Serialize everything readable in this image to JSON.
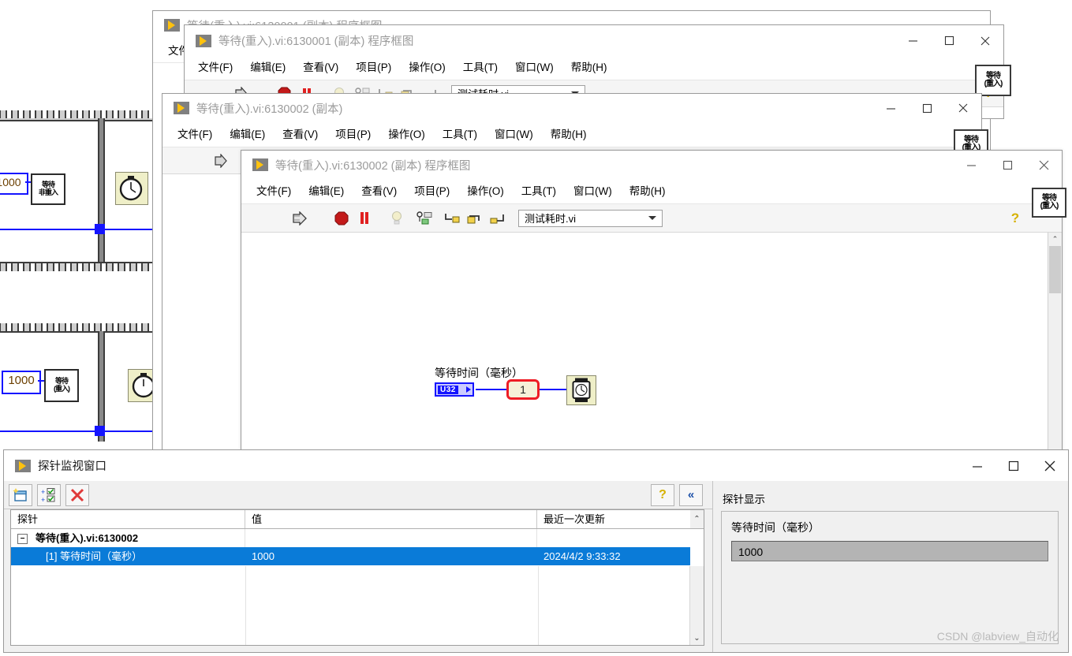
{
  "background_diagram": {
    "name": "caller-block-diagram",
    "constants": [
      "1000",
      "1000"
    ],
    "subvi_top": {
      "line1": "等待",
      "line2": "非重入"
    },
    "subvi_bottom": {
      "line1": "等待",
      "line2": "(重入)"
    },
    "timer_icon": "stopwatch-icon"
  },
  "window_back1": {
    "title": "等待(重入).vi:6130001 (副本) 程序框图",
    "menus": [
      "文件(F)",
      "编辑(E)",
      "查看(V)",
      "项目(P)",
      "操作(O)",
      "工具(T)",
      "窗口(W)",
      "帮助(H)"
    ],
    "vi_selector": "测试耗时.vi",
    "vi_icon": {
      "line1": "等待",
      "line2": "(重入)"
    },
    "help_icon": "question-mark-icon",
    "buttons": {
      "minimize": "─",
      "maximize": "☐",
      "close": "✕"
    }
  },
  "window_back2": {
    "title": "等待(重入).vi:6130002 (副本)",
    "menus": [
      "文件(F)",
      "编辑(E)",
      "查看(V)",
      "项目(P)",
      "操作(O)",
      "工具(T)",
      "窗口(W)",
      "帮助(H)"
    ],
    "vi_icon": {
      "line1": "等待",
      "line2": "(重入)"
    },
    "buttons": {
      "minimize": "─",
      "maximize": "☐",
      "close": "✕"
    }
  },
  "window_front": {
    "title": "等待(重入).vi:6130002 (副本) 程序框图",
    "menus": [
      "文件(F)",
      "编辑(E)",
      "查看(V)",
      "项目(P)",
      "操作(O)",
      "工具(T)",
      "窗口(W)",
      "帮助(H)"
    ],
    "toolbar": {
      "run_icon": "run-arrow-icon",
      "abort_icon": "abort-stop-icon",
      "pause_icon": "pause-icon",
      "highlight_icon": "light-bulb-icon",
      "retain_values_icon": "retain-wire-values-icon",
      "step_into_icon": "step-into-icon",
      "step_over_icon": "step-over-icon",
      "step_out_icon": "step-out-icon",
      "vi_selector": "测试耗时.vi",
      "help_icon": "question-mark-icon"
    },
    "vi_icon": {
      "line1": "等待",
      "line2": "(重入)"
    },
    "diagram": {
      "label": "等待时间（毫秒）",
      "terminal_type": "U32",
      "probe_number": "1",
      "wait_node_icon": "wait-ms-watch-icon"
    },
    "buttons": {
      "minimize": "─",
      "maximize": "☐",
      "close": "✕"
    }
  },
  "probe_window": {
    "title": "探针监视窗口",
    "buttons": {
      "minimize": "─",
      "maximize": "☐",
      "close": "✕"
    },
    "toolbar": {
      "new_probe_icon": "new-probe-window-icon",
      "insert_probes_icon": "insert-probes-icon",
      "delete_probe_icon": "delete-probe-icon",
      "help_icon": "question-mark-icon",
      "collapse_icon": "double-chevron-left-icon"
    },
    "columns": [
      "探针",
      "值",
      "最近一次更新"
    ],
    "rows": [
      {
        "probe": "等待(重入).vi:6130002",
        "value": "",
        "updated": "",
        "group": true,
        "expander": "−",
        "selected": false
      },
      {
        "probe": "[1] 等待时间（毫秒）",
        "value": "1000",
        "updated": "2024/4/2 9:33:32",
        "group": false,
        "selected": true
      }
    ],
    "detail": {
      "header": "探针显示",
      "label": "等待时间（毫秒）",
      "value": "1000"
    },
    "scroll": {
      "up": "⌃",
      "down": "⌄"
    }
  },
  "watermark": "CSDN @labview_自动化",
  "colors": {
    "selection": "#0a7bd8",
    "probe_border": "#ee1c25",
    "terminal_blue": "#1414ff",
    "vi_yellow": "#FFC20E",
    "node_fill": "#efefc8"
  }
}
